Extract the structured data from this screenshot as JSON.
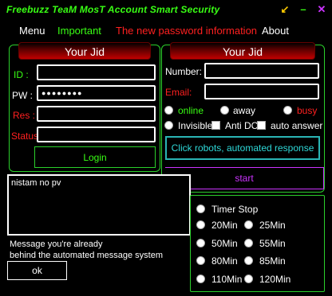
{
  "window": {
    "title": "Freebuzz TeaM MosT Account Smart Security",
    "minimize_glyph": "↙",
    "restore_glyph": "–",
    "close_glyph": "✕",
    "colors": {
      "minimize": "#ffcc00",
      "restore": "#39ff14",
      "close": "#cc33ff"
    }
  },
  "menu": {
    "menu": "Menu",
    "important": "Important",
    "new_password": "The new password information",
    "about": "About"
  },
  "left_panel": {
    "header": "Your Jid",
    "id_label": "ID :",
    "id_value": "",
    "pw_label": "PW :",
    "pw_value": "●●●●●●●●",
    "res_label": "Res :",
    "res_value": "",
    "status_label": "Status",
    "status_value": "",
    "login_button": "Login"
  },
  "right_panel": {
    "header": "Your Jid",
    "number_label": "Number:",
    "number_value": "",
    "email_label": "Email:",
    "email_value": "",
    "status_options": {
      "online": "online",
      "away": "away",
      "busy": "busy",
      "invisible": "Invisible"
    },
    "anti_dc": "Anti DC",
    "auto_answer": "auto answer",
    "robots_button": "Click robots, automated response",
    "start_button": "start"
  },
  "message": {
    "text": "nistam no pv",
    "caption_line1": "Message you're already",
    "caption_line2": "behind the automated message system",
    "ok_button": "ok"
  },
  "timer": {
    "stop": "Timer Stop",
    "options": [
      "20Min",
      "25Min",
      "50Min",
      "55Min",
      "80Min",
      "85Min",
      "110Min",
      "120Min"
    ]
  }
}
